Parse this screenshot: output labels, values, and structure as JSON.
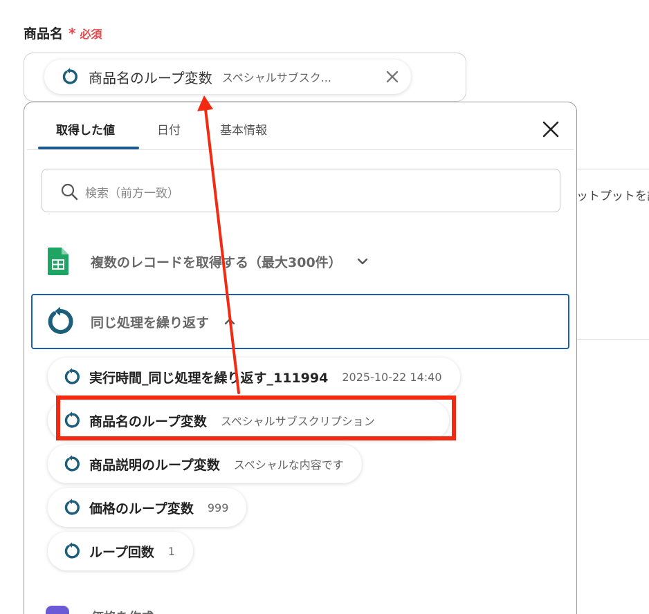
{
  "field": {
    "label": "商品名",
    "required_star": "*",
    "required_text": "必須"
  },
  "input": {
    "chip": {
      "icon": "loop-icon",
      "label": "商品名のループ変数",
      "value": "スペシャルサブスク..."
    },
    "clear_icon": "close-icon"
  },
  "panel": {
    "tabs": [
      {
        "label": "取得した値",
        "active": true
      },
      {
        "label": "日付",
        "active": false
      },
      {
        "label": "基本情報",
        "active": false
      }
    ],
    "close_icon": "close-icon",
    "search": {
      "icon": "search-icon",
      "placeholder": "検索（前方一致）"
    },
    "groups": [
      {
        "icon": "google-sheets-icon",
        "title": "複数のレコードを取得する（最大300件）",
        "expanded": false
      },
      {
        "icon": "loop-icon",
        "title": "同じ処理を繰り返す",
        "expanded": true
      }
    ],
    "items": [
      {
        "label": "実行時間_同じ処理を繰り返す_111994",
        "value": "2025-10-22 14:40"
      },
      {
        "label": "商品名のループ変数",
        "value": "スペシャルサブスクリプション",
        "highlighted": true
      },
      {
        "label": "商品説明のループ変数",
        "value": "スペシャルな内容です"
      },
      {
        "label": "価格のループ変数",
        "value": "999"
      },
      {
        "label": "ループ回数",
        "value": "1"
      }
    ],
    "partial_group": {
      "title": "価格を作成"
    }
  },
  "background": {
    "partial_text": "ットプットを設"
  },
  "colors": {
    "required": "#e5484d",
    "tab_underline": "#1f5a8e",
    "loop_icon": "#1d5f7a",
    "group_selected_border": "#1f5fa8",
    "annotation_red": "#f22a12",
    "sheets_green": "#1fa463"
  }
}
